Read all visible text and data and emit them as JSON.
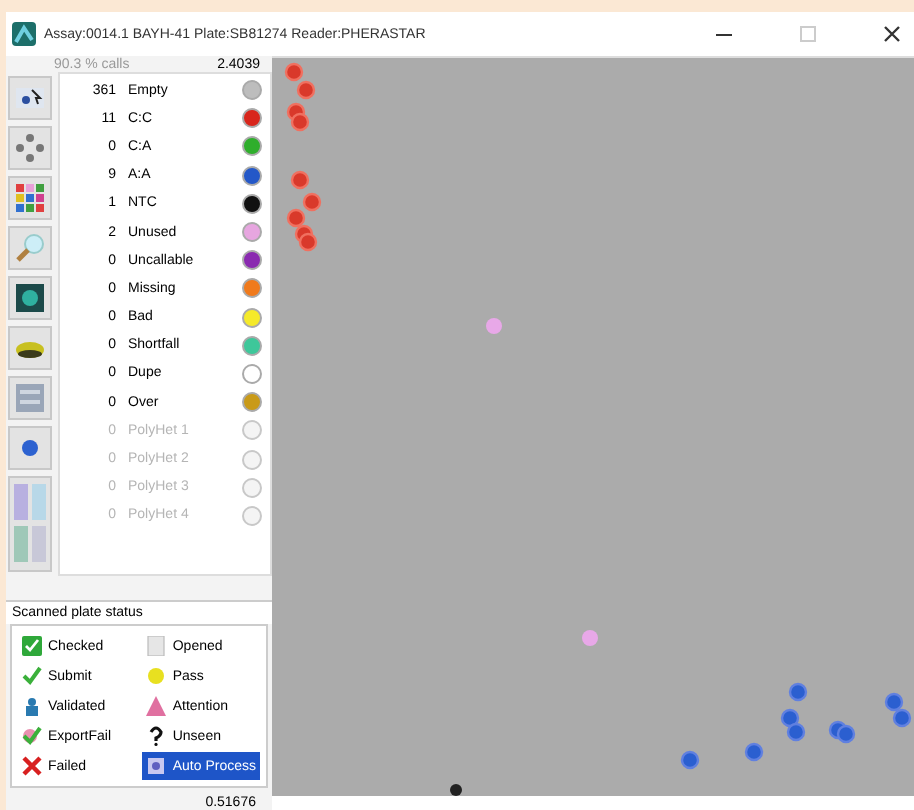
{
  "window": {
    "title": "Assay:0014.1 BAYH-41  Plate:SB81274  Reader:PHERASTAR"
  },
  "header": {
    "label": "90.3 % calls",
    "value": "2.4039"
  },
  "legend": [
    {
      "count": "361",
      "label": "Empty",
      "color": "#bdbdbd",
      "disabled": false
    },
    {
      "count": "11",
      "label": "C:C",
      "color": "#d8261c",
      "disabled": false
    },
    {
      "count": "0",
      "label": "C:A",
      "color": "#2fae2c",
      "disabled": false
    },
    {
      "count": "9",
      "label": "A:A",
      "color": "#2458c8",
      "disabled": false
    },
    {
      "count": "1",
      "label": "NTC",
      "color": "#111111",
      "disabled": false
    },
    {
      "count": "2",
      "label": "Unused",
      "color": "#e7a6e0",
      "disabled": false
    },
    {
      "count": "0",
      "label": "Uncallable",
      "color": "#8a2ab0",
      "disabled": false
    },
    {
      "count": "0",
      "label": "Missing",
      "color": "#f07a1c",
      "disabled": false
    },
    {
      "count": "0",
      "label": "Bad",
      "color": "#f5ea2a",
      "disabled": false
    },
    {
      "count": "0",
      "label": "Shortfall",
      "color": "#3ec79a",
      "disabled": false
    },
    {
      "count": "0",
      "label": "Dupe",
      "color": "#ffffff",
      "disabled": false
    },
    {
      "count": "0",
      "label": "Over",
      "color": "#c99a18",
      "disabled": false
    },
    {
      "count": "0",
      "label": "PolyHet 1",
      "color": "#f4f4f4",
      "disabled": true
    },
    {
      "count": "0",
      "label": "PolyHet 2",
      "color": "#f4f4f4",
      "disabled": true
    },
    {
      "count": "0",
      "label": "PolyHet 3",
      "color": "#f4f4f4",
      "disabled": true
    },
    {
      "count": "0",
      "label": "PolyHet 4",
      "color": "#f4f4f4",
      "disabled": true
    }
  ],
  "status_title": "Scanned plate status",
  "statuses": [
    {
      "label": "Checked",
      "selected": false
    },
    {
      "label": "Opened",
      "selected": false
    },
    {
      "label": "Submit",
      "selected": false
    },
    {
      "label": "Pass",
      "selected": false
    },
    {
      "label": "Validated",
      "selected": false
    },
    {
      "label": "Attention",
      "selected": false
    },
    {
      "label": "ExportFail",
      "selected": false
    },
    {
      "label": "Unseen",
      "selected": false
    },
    {
      "label": "Failed",
      "selected": false
    },
    {
      "label": "Auto Process",
      "selected": true
    }
  ],
  "footer_value": "0.51676"
}
